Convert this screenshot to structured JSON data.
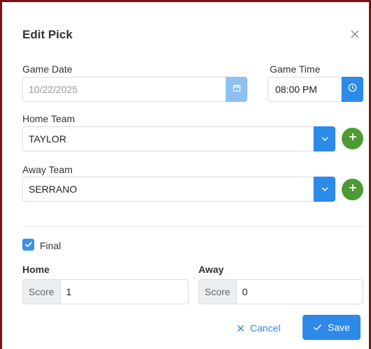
{
  "modal": {
    "title": "Edit Pick",
    "close_icon": "close-icon"
  },
  "game_date": {
    "label": "Game Date",
    "value": "10/22/2025",
    "icon": "calendar-icon"
  },
  "game_time": {
    "label": "Game Time",
    "value": "08:00 PM",
    "icon": "clock-icon"
  },
  "home_team": {
    "label": "Home Team",
    "value": "TAYLOR",
    "dropdown_icon": "chevron-down-icon",
    "add_icon": "plus-icon"
  },
  "away_team": {
    "label": "Away Team",
    "value": "SERRANO",
    "dropdown_icon": "chevron-down-icon",
    "add_icon": "plus-icon"
  },
  "final": {
    "label": "Final",
    "checked": true
  },
  "scores": {
    "home_label": "Home",
    "away_label": "Away",
    "prefix": "Score",
    "home_value": "1",
    "away_value": "0"
  },
  "actions": {
    "cancel_label": "Cancel",
    "save_label": "Save"
  },
  "colors": {
    "accent": "#2d8ae8",
    "add": "#4d9a35",
    "border": "#7a1212"
  }
}
